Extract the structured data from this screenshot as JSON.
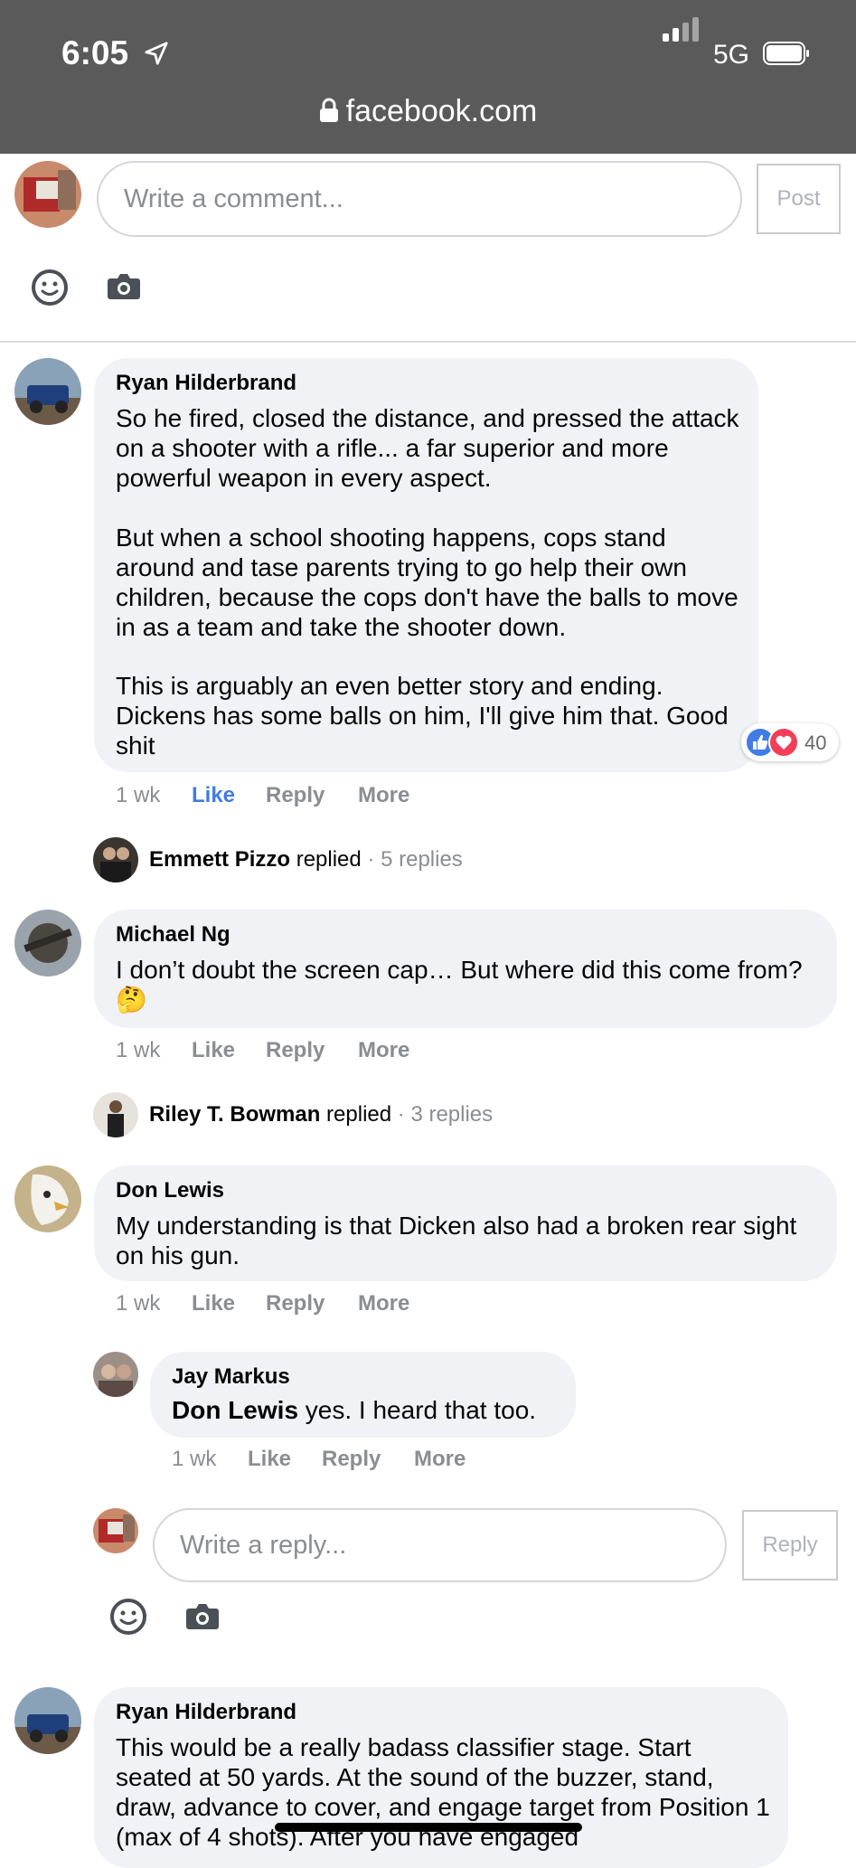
{
  "status_bar": {
    "time": "6:05",
    "network": "5G",
    "url": "facebook.com"
  },
  "top_composer": {
    "placeholder": "Write a comment...",
    "post_label": "Post"
  },
  "comments": [
    {
      "author": "Ryan Hilderbrand",
      "paragraphs": [
        "So he fired, closed the distance, and pressed the attack on a shooter with a rifle... a far superior and more powerful weapon in every aspect.",
        "But when a school shooting happens, cops stand around and tase parents trying to go help their own children, because the cops don't have the balls to move in as a team and take the shooter down.",
        "This is arguably an even better story and ending. Dickens has some balls on him, I'll give him that. Good shit"
      ],
      "reaction_count": "40",
      "time": "1 wk",
      "like": "Like",
      "reply": "Reply",
      "more": "More",
      "replied": {
        "name": "Emmett Pizzo",
        "verb": "replied",
        "sep": "·",
        "count": "5 replies"
      }
    },
    {
      "author": "Michael Ng",
      "text": "I don’t doubt the screen cap… But where did this come from?",
      "emoji": "🤔",
      "time": "1 wk",
      "like": "Like",
      "reply": "Reply",
      "more": "More",
      "replied": {
        "name": "Riley T. Bowman",
        "verb": "replied",
        "sep": "·",
        "count": "3 replies"
      }
    },
    {
      "author": "Don Lewis",
      "text": "My understanding is that Dicken also had a broken rear sight on his gun.",
      "time": "1 wk",
      "like": "Like",
      "reply": "Reply",
      "more": "More"
    }
  ],
  "nested_reply": {
    "author": "Jay Markus",
    "mention": "Don Lewis",
    "text": " yes. I heard that too.",
    "time": "1 wk",
    "like": "Like",
    "reply": "Reply",
    "more": "More"
  },
  "reply_composer": {
    "placeholder": "Write a reply...",
    "reply_label": "Reply"
  },
  "last_comment": {
    "author": "Ryan Hilderbrand",
    "text": "This would be a really badass classifier stage. Start seated at 50 yards. At the sound of the buzzer, stand, draw, advance to cover, and engage target from Position 1 (max of 4 shots). After you have engaged"
  },
  "icons": [
    "location-arrow-icon",
    "signal-icon",
    "battery-icon",
    "lock-icon",
    "emoji-icon",
    "camera-icon",
    "like-reaction-icon",
    "love-reaction-icon"
  ],
  "colors": {
    "status_bar": "#5a5a5a",
    "bubble": "#f0f2f5",
    "like_blue": "#3f7ce6",
    "love_red": "#f33e58"
  }
}
